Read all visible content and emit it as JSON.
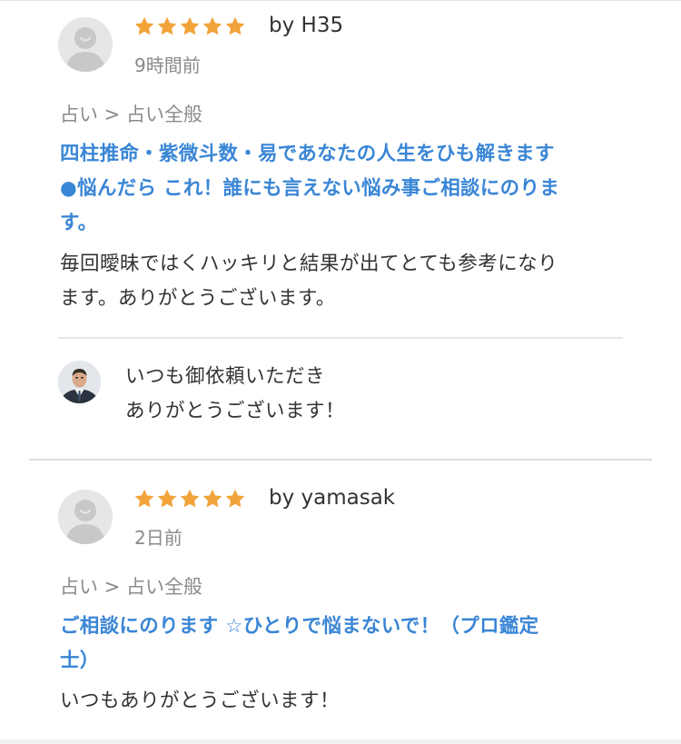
{
  "colors": {
    "star": "#f2a33a",
    "link": "#3a86d6",
    "muted": "#8a8a8a",
    "text": "#333333"
  },
  "reviews": [
    {
      "rating": 5,
      "reviewer": "by H35",
      "time": "9時間前",
      "category": "占い > 占い全般",
      "service_title_lines": [
        "四柱推命・紫微斗数・易であなたの人生をひも解きます",
        "●悩んだら これ！誰にも言えない悩み事ご相談にのりま",
        "す。"
      ],
      "body_lines": [
        "毎回曖昧ではくハッキリと結果が出てとても参考になり",
        "ます。ありがとうございます。"
      ],
      "reply_lines": [
        "いつも御依頼いただき",
        "ありがとうございます！"
      ]
    },
    {
      "rating": 5,
      "reviewer": "by yamasak",
      "time": "2日前",
      "category": "占い > 占い全般",
      "service_title_lines": [
        "ご相談にのります ☆ひとりで悩まないで！（プロ鑑定",
        "士）"
      ],
      "body_lines": [
        "いつもありがとうございます！"
      ]
    }
  ]
}
